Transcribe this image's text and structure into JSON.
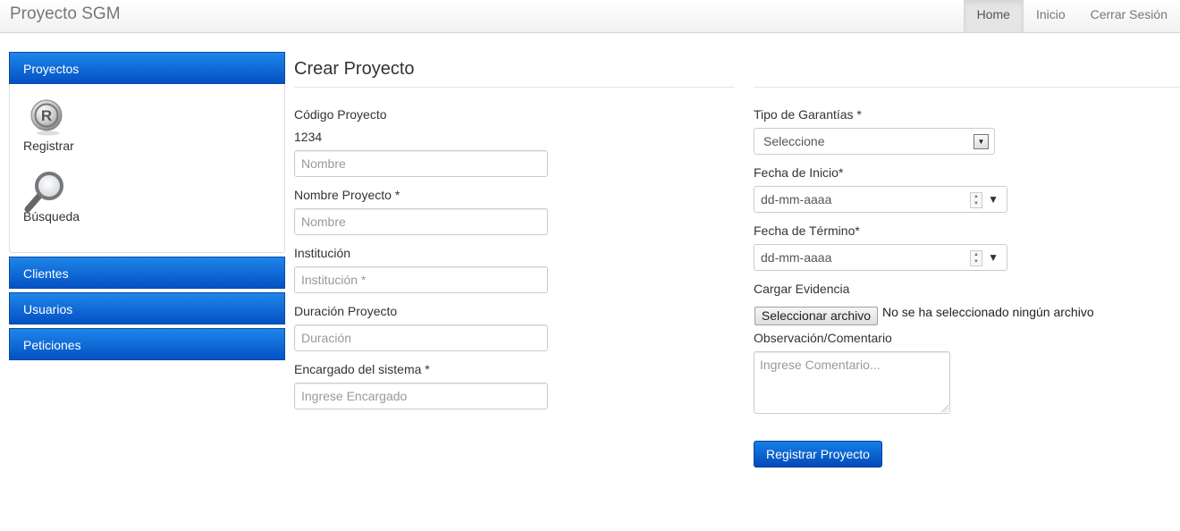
{
  "navbar": {
    "brand": "Proyecto SGM",
    "items": [
      {
        "label": "Home",
        "active": true
      },
      {
        "label": "Inicio",
        "active": false
      },
      {
        "label": "Cerrar Sesión",
        "active": false
      }
    ]
  },
  "sidebar": {
    "proyectos": {
      "label": "Proyectos",
      "links": [
        {
          "label": "Registrar",
          "icon": "registered-icon"
        },
        {
          "label": "Búsqueda",
          "icon": "magnifier-icon"
        }
      ]
    },
    "groups": [
      {
        "label": "Clientes"
      },
      {
        "label": "Usuarios"
      },
      {
        "label": "Peticiones"
      }
    ]
  },
  "main": {
    "title": "Crear Proyecto",
    "left": {
      "codigo_label": "Código Proyecto",
      "codigo_value": "1234",
      "codigo_placeholder": "Nombre",
      "nombre_label": "Nombre Proyecto *",
      "nombre_placeholder": "Nombre",
      "institucion_label": "Institución",
      "institucion_placeholder": "Institución *",
      "duracion_label": "Duración Proyecto",
      "duracion_placeholder": "Duración",
      "encargado_label": "Encargado del sistema *",
      "encargado_placeholder": "Ingrese Encargado"
    },
    "right": {
      "garantias_label": "Tipo de Garantías *",
      "garantias_selected": "Seleccione",
      "inicio_label": "Fecha de Inicio*",
      "inicio_value": "dd-mm-aaaa",
      "termino_label": "Fecha de Término*",
      "termino_value": "dd-mm-aaaa",
      "evidencia_label": "Cargar Evidencia",
      "file_button": "Seleccionar archivo",
      "file_status": "No se ha seleccionado ningún archivo",
      "comentario_label": "Observación/Comentario",
      "comentario_placeholder": "Ingrese Comentario...",
      "submit_label": "Registrar Proyecto"
    }
  },
  "colors": {
    "sidebar_gradient_top": "#1e86ea",
    "sidebar_gradient_bottom": "#0451c4",
    "button_primary": "#0a5fd0"
  }
}
